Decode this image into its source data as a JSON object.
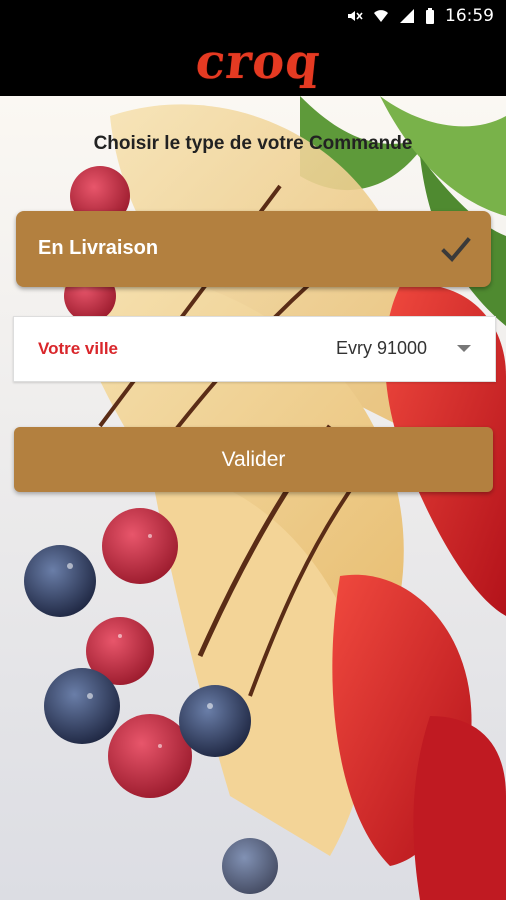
{
  "status_bar": {
    "time": "16:59",
    "icons": [
      "mute-icon",
      "wifi-icon",
      "signal-icon",
      "battery-icon"
    ]
  },
  "app": {
    "logo_text": "croq",
    "logo_color": "#e53a22"
  },
  "order_type": {
    "title": "Choisir le type de votre Commande",
    "options": [
      {
        "label": "En Livraison",
        "selected": true
      }
    ]
  },
  "city": {
    "label": "Votre ville",
    "value": "Evry 91000"
  },
  "submit": {
    "label": "Valider"
  },
  "colors": {
    "accent": "#b3803f",
    "label_red": "#d9262b"
  }
}
